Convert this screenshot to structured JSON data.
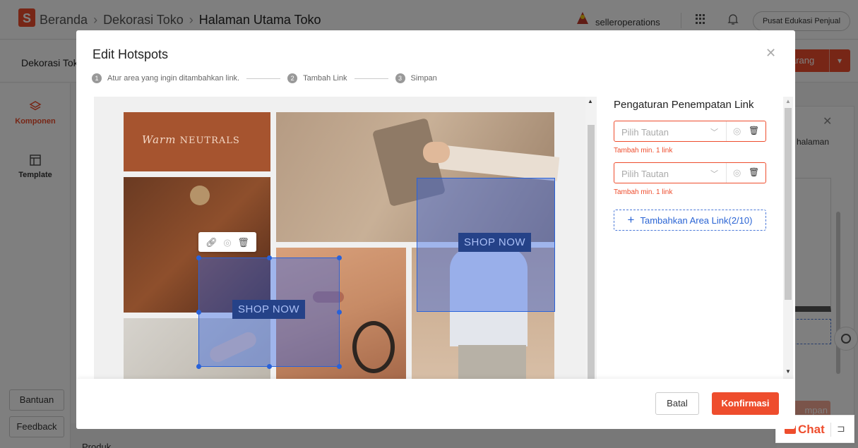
{
  "header": {
    "breadcrumb": [
      "Beranda",
      "Dekorasi Toko",
      "Halaman Utama Toko"
    ],
    "seller": "selleroperations",
    "edu_button": "Pusat Edukasi Penjual"
  },
  "subbar": {
    "title": "Dekorasi Toko",
    "save_fragment": "arang"
  },
  "sidebar": {
    "items": [
      {
        "label": "Komponen",
        "icon": "layers-icon"
      },
      {
        "label": "Template",
        "icon": "template-icon"
      }
    ],
    "help": "Bantuan",
    "feedback": "Feedback"
  },
  "right_panel": {
    "text": "halaman",
    "button_fragment": "mpan"
  },
  "bottom": {
    "product_label": "Produk",
    "chat_label": "Chat"
  },
  "modal": {
    "title": "Edit Hotspots",
    "steps": [
      {
        "num": "1",
        "label": "Atur area yang ingin ditambahkan link."
      },
      {
        "num": "2",
        "label": "Tambah Link"
      },
      {
        "num": "3",
        "label": "Simpan"
      }
    ],
    "image": {
      "brand_text": "NEUTRALS",
      "brand_script": "Warm",
      "shop_now_labels": [
        "SHOP NOW",
        "SHOP NOW"
      ]
    },
    "settings": {
      "title": "Pengaturan Penempatan Link",
      "links": [
        {
          "placeholder": "Pilih Tautan",
          "error": "Tambah min. 1 link"
        },
        {
          "placeholder": "Pilih Tautan",
          "error": "Tambah min. 1 link"
        }
      ],
      "add_area": "Tambahkan Area Link(2/10)"
    },
    "footer": {
      "cancel": "Batal",
      "confirm": "Konfirmasi"
    }
  },
  "colors": {
    "brand": "#ee4d2d",
    "hotspot": "#2962d9",
    "link_blue": "#2a64d4"
  }
}
